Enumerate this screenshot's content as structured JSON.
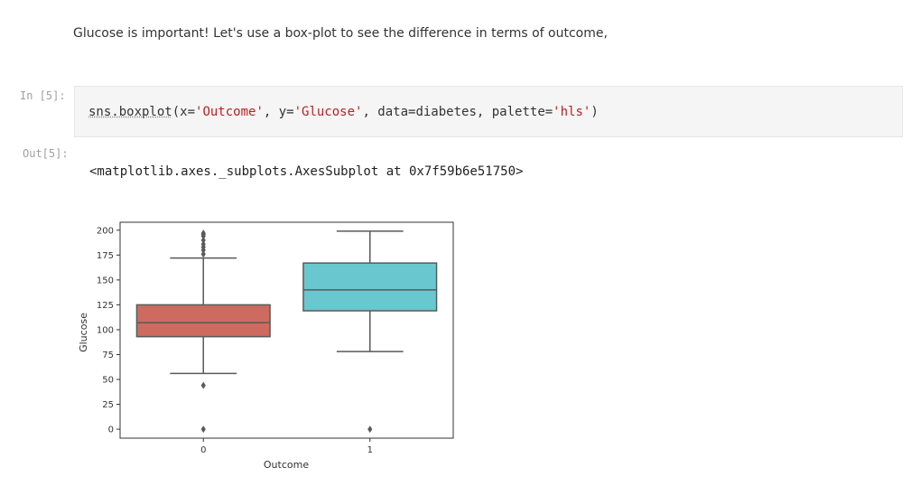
{
  "markdown": {
    "text": "Glucose is important! Let's use a box-plot to see the difference in terms of outcome,"
  },
  "cell": {
    "in_prompt": "In [5]:",
    "out_prompt": "Out[5]:",
    "code": {
      "fn": "sns.boxplot",
      "p1": "(x=",
      "s1": "'Outcome'",
      "p2": ", y=",
      "s2": "'Glucose'",
      "p3": ", data=diabetes, palette=",
      "s3": "'hls'",
      "p4": ")"
    },
    "output_text": "<matplotlib.axes._subplots.AxesSubplot at 0x7f59b6e51750>"
  },
  "chart_data": {
    "type": "box",
    "xlabel": "Outcome",
    "ylabel": "Glucose",
    "categories": [
      "0",
      "1"
    ],
    "yticks": [
      "0",
      "25",
      "50",
      "75",
      "100",
      "125",
      "150",
      "175",
      "200"
    ],
    "ylim": [
      -9,
      208
    ],
    "colors": [
      "#cd6b61",
      "#69c8cf"
    ],
    "boxes": [
      {
        "category": "0",
        "whislo": 56,
        "q1": 93,
        "median": 107,
        "q3": 125,
        "whishi": 172,
        "fliers": [
          0,
          44,
          176,
          180,
          183,
          186,
          190,
          194,
          196,
          197
        ]
      },
      {
        "category": "1",
        "whislo": 78,
        "q1": 119,
        "median": 140,
        "q3": 167,
        "whishi": 199,
        "fliers": [
          0
        ]
      }
    ]
  }
}
